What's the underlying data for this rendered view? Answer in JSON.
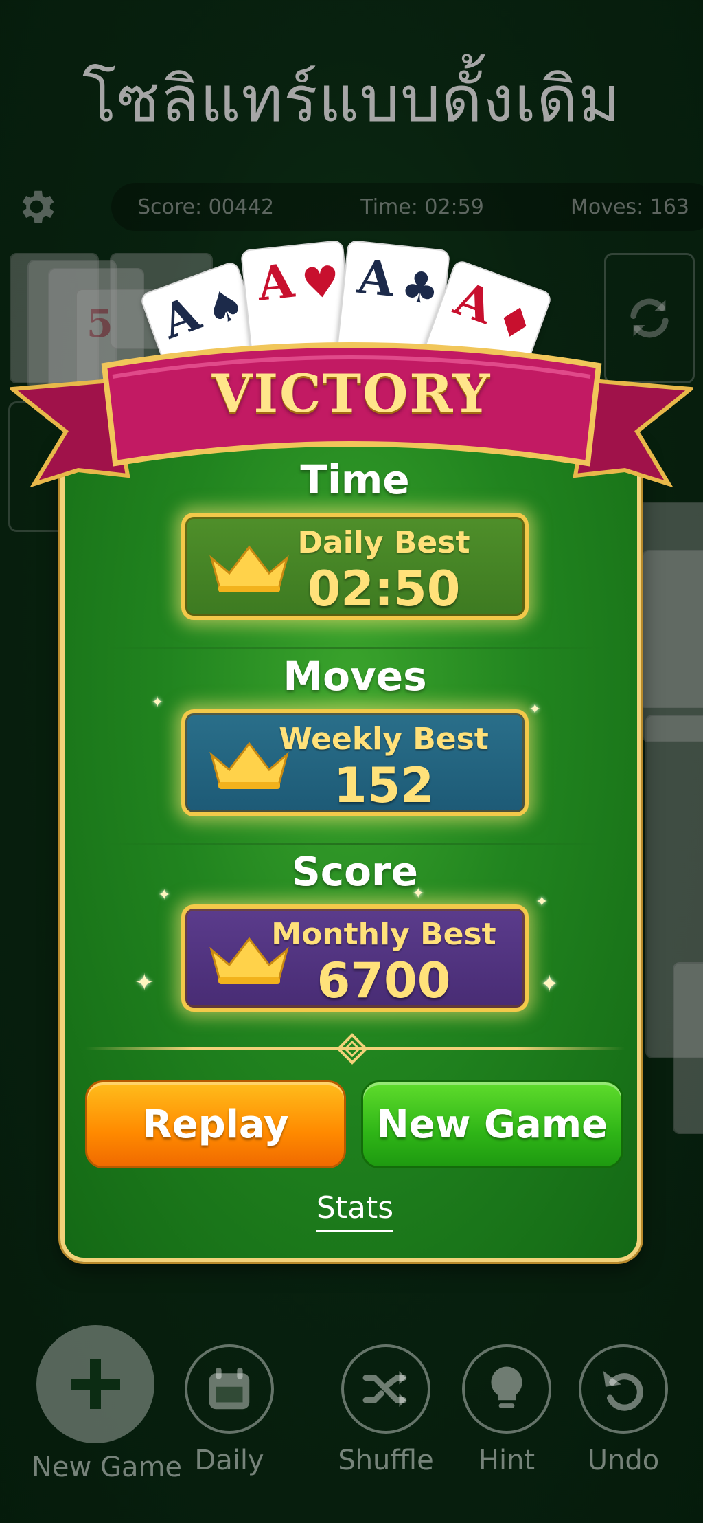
{
  "headline": "โซลิแทร์แบบดั้งเดิม",
  "stats_bar": {
    "score": "Score: 00442",
    "time": "Time: 02:59",
    "moves": "Moves: 163"
  },
  "background_cards": {
    "waste_rank": "5"
  },
  "fan_cards": [
    {
      "rank": "A",
      "suit": "♠",
      "color": "#1c2a4a"
    },
    {
      "rank": "A",
      "suit": "♥",
      "color": "#c8102e"
    },
    {
      "rank": "A",
      "suit": "♣",
      "color": "#1c2a4a"
    },
    {
      "rank": "A",
      "suit": "♦",
      "color": "#c8102e"
    }
  ],
  "dialog": {
    "banner": "VICTORY",
    "sections": [
      {
        "title": "Time",
        "best_label": "Daily Best",
        "best_value": "02:50",
        "theme": "green"
      },
      {
        "title": "Moves",
        "best_label": "Weekly Best",
        "best_value": "152",
        "theme": "blue"
      },
      {
        "title": "Score",
        "best_label": "Monthly Best",
        "best_value": "6700",
        "theme": "purple"
      }
    ],
    "replay_label": "Replay",
    "new_game_label": "New Game",
    "stats_label": "Stats"
  },
  "toolbar": [
    {
      "label": "New Game",
      "icon": "plus-icon"
    },
    {
      "label": "Daily",
      "icon": "calendar-icon"
    },
    {
      "label": "Shuffle",
      "icon": "shuffle-icon"
    },
    {
      "label": "Hint",
      "icon": "lightbulb-icon"
    },
    {
      "label": "Undo",
      "icon": "undo-icon"
    }
  ],
  "colors": {
    "felt": "#0d3317",
    "dialog_green": "#21841f",
    "gold": "#f2d27a",
    "ribbon": "#b8185a",
    "replay_orange": "#ff8a00",
    "new_game_green": "#2fb517"
  }
}
